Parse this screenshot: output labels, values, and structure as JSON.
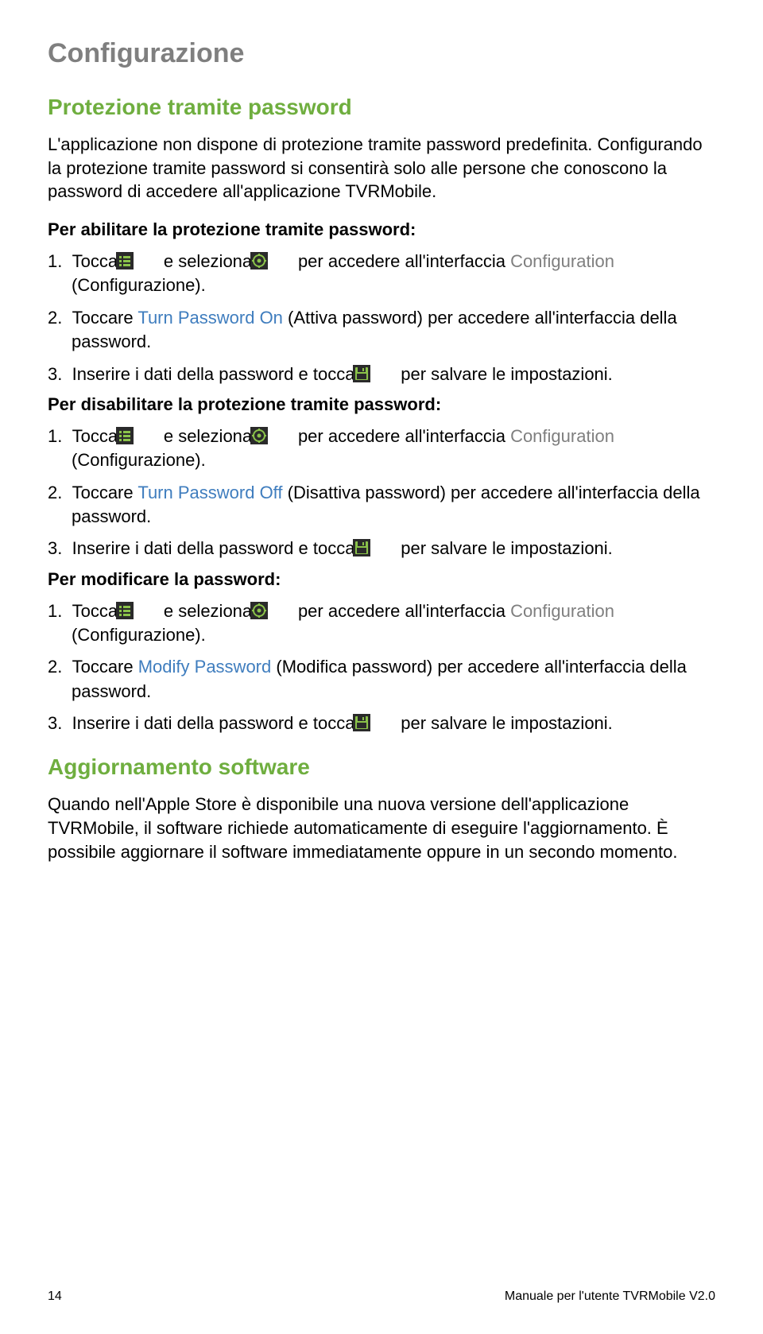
{
  "title": "Configurazione",
  "section1": {
    "heading": "Protezione tramite password",
    "intro": "L'applicazione non dispone di protezione tramite password predefinita. Configurando la protezione tramite password si consentirà solo alle persone che conoscono la password di accedere all'applicazione TVRMobile.",
    "enable": {
      "lead": "Per abilitare la protezione tramite password:",
      "s1a": "Toccare ",
      "s1b": " e selezionare ",
      "s1c": " per accedere all'interfaccia ",
      "s1d": "Configuration",
      "s1e": " (Configurazione).",
      "s2a": "Toccare ",
      "s2b": "Turn Password On",
      "s2c": " (Attiva password) per accedere all'interfaccia della password.",
      "s3a": "Inserire i dati della password e toccare ",
      "s3b": " per salvare le impostazioni."
    },
    "disable": {
      "lead": "Per disabilitare la protezione tramite password:",
      "s1a": "Toccare ",
      "s1b": " e selezionare ",
      "s1c": " per accedere all'interfaccia ",
      "s1d": "Configuration",
      "s1e": " (Configurazione).",
      "s2a": "Toccare ",
      "s2b": "Turn Password Off",
      "s2c": " (Disattiva password) per accedere all'interfaccia della password.",
      "s3a": "Inserire i dati della password e toccare ",
      "s3b": " per salvare le impostazioni."
    },
    "modify": {
      "lead": "Per modificare la password:",
      "s1a": "Toccare ",
      "s1b": " e selezionare ",
      "s1c": " per accedere all'interfaccia ",
      "s1d": "Configuration",
      "s1e": " (Configurazione).",
      "s2a": "Toccare ",
      "s2b": "Modify Password",
      "s2c": " (Modifica password) per accedere all'interfaccia della password.",
      "s3a": "Inserire i dati della password e toccare ",
      "s3b": " per salvare le impostazioni."
    }
  },
  "section2": {
    "heading": "Aggiornamento software",
    "body": "Quando nell'Apple Store è disponibile una nuova versione dell'applicazione TVRMobile, il software richiede automaticamente di eseguire l'aggiornamento. È possibile aggiornare il software immediatamente oppure in un secondo momento."
  },
  "footer": {
    "page": "14",
    "doc": "Manuale per l'utente TVRMobile V2.0"
  }
}
